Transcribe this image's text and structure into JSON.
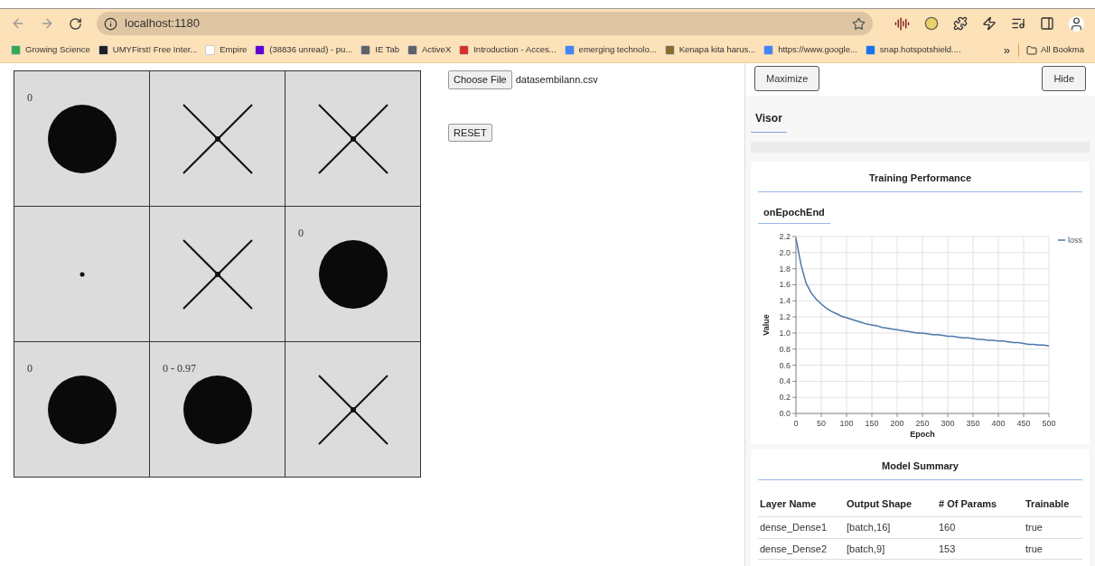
{
  "browser": {
    "url": "localhost:1180",
    "bookmarks": [
      {
        "label": "Growing Science",
        "color": "#34a853"
      },
      {
        "label": "UMYFirst! Free Inter...",
        "color": "#202124"
      },
      {
        "label": "Empire",
        "color": "#ffffff"
      },
      {
        "label": "(38836 unread) - pu...",
        "color": "#6001d2"
      },
      {
        "label": "IE Tab",
        "color": "#5f6368"
      },
      {
        "label": "ActiveX",
        "color": "#5f6368"
      },
      {
        "label": "Introduction - Acces...",
        "color": "#d93025"
      },
      {
        "label": "emerging technolo...",
        "color": "#4285f4"
      },
      {
        "label": "Kenapa kita harus...",
        "color": "#8a6d2b"
      },
      {
        "label": "https://www.google...",
        "color": "#4285f4"
      },
      {
        "label": "snap.hotspotshield....",
        "color": "#1a73e8"
      }
    ],
    "more": "»",
    "all_bookmarks": "All Bookma"
  },
  "board": {
    "cells": [
      {
        "kind": "circle",
        "label": "0"
      },
      {
        "kind": "cross"
      },
      {
        "kind": "cross"
      },
      {
        "kind": "dot"
      },
      {
        "kind": "cross"
      },
      {
        "kind": "circle",
        "label": "0"
      },
      {
        "kind": "circle",
        "label": "0"
      },
      {
        "kind": "circle",
        "label": "0 - 0.97"
      },
      {
        "kind": "cross"
      }
    ]
  },
  "file_input": {
    "button": "Choose File",
    "filename": "datasembilann.csv"
  },
  "reset_button": "RESET",
  "visor": {
    "maximize_button": "Maximize",
    "hide_button": "Hide",
    "tab": "Visor",
    "training": {
      "title": "Training Performance",
      "subtab": "onEpochEnd",
      "chart_data": {
        "type": "line",
        "xlabel": "Epoch",
        "ylabel": "Value",
        "xlim": [
          0,
          500
        ],
        "ylim": [
          0,
          2.2
        ],
        "xticks": [
          0,
          50,
          100,
          150,
          200,
          250,
          300,
          350,
          400,
          450,
          500
        ],
        "grid": true,
        "yticks": [
          {
            "value": 0,
            "label": "0.0"
          },
          {
            "value": 0.2,
            "label": "0.2"
          },
          {
            "value": 0.4,
            "label": "0.4"
          },
          {
            "value": 0.6,
            "label": "0.6"
          },
          {
            "value": 0.8,
            "label": "0.8"
          },
          {
            "value": 1,
            "label": "1.0"
          },
          {
            "value": 1.2,
            "label": "1.2"
          },
          {
            "value": 1.4,
            "label": "1.4"
          },
          {
            "value": 1.6,
            "label": "1.6"
          },
          {
            "value": 1.8,
            "label": "1.8"
          },
          {
            "value": 2,
            "label": "2.0"
          },
          {
            "value": 2.2,
            "label": "2.2"
          }
        ],
        "x": [
          0,
          10,
          20,
          30,
          40,
          50,
          60,
          70,
          80,
          90,
          100,
          110,
          120,
          130,
          140,
          150,
          160,
          170,
          180,
          190,
          200,
          210,
          220,
          230,
          240,
          250,
          260,
          270,
          280,
          290,
          300,
          310,
          320,
          330,
          340,
          350,
          360,
          370,
          380,
          390,
          400,
          410,
          420,
          430,
          440,
          450,
          460,
          470,
          480,
          490,
          500
        ],
        "series": [
          {
            "name": "loss",
            "color": "#4c78a8",
            "values": [
              2.18,
              1.85,
              1.62,
              1.5,
              1.42,
              1.36,
              1.31,
              1.27,
              1.24,
              1.21,
              1.19,
              1.17,
              1.15,
              1.13,
              1.11,
              1.1,
              1.09,
              1.07,
              1.06,
              1.05,
              1.04,
              1.03,
              1.02,
              1.01,
              1.0,
              1.0,
              0.99,
              0.98,
              0.98,
              0.97,
              0.96,
              0.96,
              0.95,
              0.94,
              0.94,
              0.93,
              0.92,
              0.92,
              0.91,
              0.91,
              0.9,
              0.9,
              0.89,
              0.88,
              0.88,
              0.87,
              0.86,
              0.86,
              0.85,
              0.85,
              0.84
            ]
          }
        ]
      }
    },
    "model_summary": {
      "title": "Model Summary",
      "columns": [
        "Layer Name",
        "Output Shape",
        "# Of Params",
        "Trainable"
      ],
      "rows": [
        [
          "dense_Dense1",
          "[batch,16]",
          "160",
          "true"
        ],
        [
          "dense_Dense2",
          "[batch,9]",
          "153",
          "true"
        ]
      ]
    }
  }
}
